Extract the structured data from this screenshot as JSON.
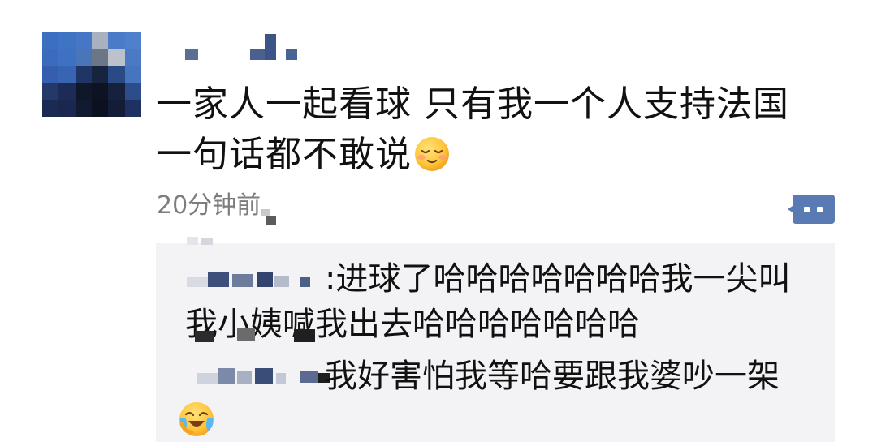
{
  "post": {
    "text_line1": "一家人一起看球 只有我一个人支持法国",
    "text_line2": "一句话都不敢说",
    "emoji": "pensive-smile-emoji",
    "time": "20分钟前"
  },
  "comments": [
    {
      "separator": ":",
      "text_line1": "进球了哈哈哈哈哈哈哈我一尖叫",
      "text_line2": "我小姨喊我出去哈哈哈哈哈哈哈"
    },
    {
      "separator": "",
      "text_line1": "我好害怕我等哈要跟我婆吵一架",
      "emoji": "crying-laughing-emoji"
    }
  ],
  "colors": {
    "text": "#111111",
    "time": "#7d7d7d",
    "comment_bg": "#f3f3f5",
    "more_button": "#4f6fa8"
  },
  "icons": {
    "more": "comment-more-icon"
  }
}
